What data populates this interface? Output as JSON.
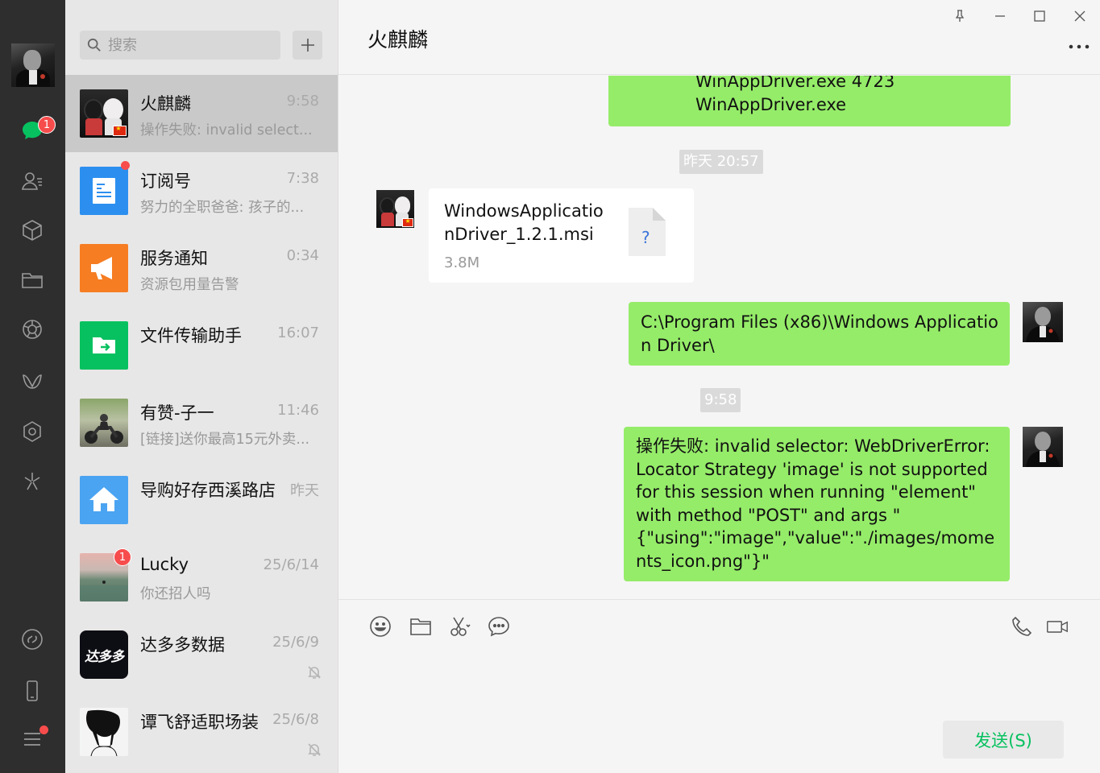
{
  "nav": {
    "chat_badge": "1"
  },
  "search": {
    "placeholder": "搜索"
  },
  "conversations": [
    {
      "name": "火麒麟",
      "time": "9:58",
      "preview": "操作失败: invalid select..."
    },
    {
      "name": "订阅号",
      "time": "7:38",
      "preview": "努力的全职爸爸: 孩子的..."
    },
    {
      "name": "服务通知",
      "time": "0:34",
      "preview": "资源包用量告警"
    },
    {
      "name": "文件传输助手",
      "time": "16:07",
      "preview": ""
    },
    {
      "name": "有赞-子一",
      "time": "11:46",
      "preview": "[链接]送你最高15元外卖..."
    },
    {
      "name": "导购好存西溪路店",
      "time": "昨天",
      "preview": ""
    },
    {
      "name": "Lucky",
      "time": "25/6/14",
      "preview": "你还招人吗",
      "badge": "1"
    },
    {
      "name": "达多多数据",
      "time": "25/6/9",
      "preview": "",
      "logo_text": "达多多"
    },
    {
      "name": "谭飞舒适职场装",
      "time": "25/6/8",
      "preview": ""
    }
  ],
  "chat": {
    "title": "火麒麟",
    "messages": {
      "m1_line1": "WinAppDriver.exe 4723",
      "m1_line2": "WinAppDriver.exe",
      "ts1": "昨天 20:57",
      "file_name": "WindowsApplicationDriver_1.2.1.msi",
      "file_size": "3.8M",
      "file_icon_glyph": "?",
      "m3": "C:\\Program Files (x86)\\Windows Application Driver\\",
      "ts2": "9:58",
      "m4": "操作失败: invalid selector: WebDriverError: Locator Strategy 'image' is not supported for this session when running \"element\" with method \"POST\" and args \"{\"using\":\"image\",\"value\":\"./images/moments_icon.png\"}\""
    },
    "send_label": "发送(S)"
  },
  "colors": {
    "nav_bg": "#2e2e2e",
    "list_bg": "#e8e7e7",
    "selected_bg": "#c9c9c9",
    "bubble_green": "#95ec69",
    "brand_green": "#07c160",
    "badge_red": "#f74c4c"
  }
}
